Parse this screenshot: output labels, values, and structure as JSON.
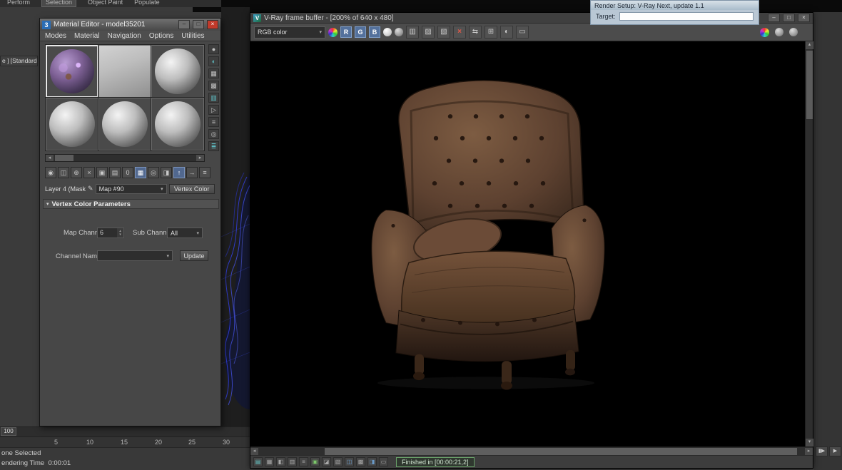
{
  "desktop": {
    "ribbon_tabs": [
      "Perform",
      "Selection",
      "Object Paint",
      "Populate"
    ],
    "left_fragment_text": "e ] [Standard",
    "timeline_ticks": [
      "5",
      "10",
      "15",
      "20",
      "25",
      "30"
    ],
    "frame_slider_value": "100",
    "status_selected": "one Selected",
    "status_render_time": "endering Time  0:00:01",
    "playback_icons": [
      "▮▶",
      "▶"
    ]
  },
  "render_setup": {
    "title": "Render Setup: V-Ray Next, update 1.1",
    "target_label": "Target:"
  },
  "material_editor": {
    "title": "Material Editor - model35201",
    "menus": [
      "Modes",
      "Material",
      "Navigation",
      "Options",
      "Utilities"
    ],
    "toolbar_icons": [
      "◉",
      "◫",
      "⊕",
      "×",
      "▣",
      "▤",
      "0",
      "▦",
      "◎",
      "◨",
      "↑",
      "→",
      "≡"
    ],
    "side_icons": [
      "●",
      "◐",
      "▦",
      "▩",
      "▥",
      "▷",
      "≡",
      "◎",
      "≣"
    ],
    "layer_label": "Layer 4 (Mask",
    "map_dropdown_value": "Map #90",
    "type_button_label": "Vertex Color",
    "rollout_title": "Vertex Color Parameters",
    "map_channel_label": "Map Channel",
    "map_channel_value": "6",
    "sub_channel_label": "Sub Channel",
    "sub_channel_value": "All",
    "channel_name_label": "Channel Name",
    "update_button_label": "Update"
  },
  "vfb": {
    "title": "V-Ray frame buffer - [200% of 640 x 480]",
    "channel_select_value": "RGB color",
    "rgb_buttons": [
      "R",
      "G",
      "B"
    ],
    "tool_icons": [
      "▥",
      "▨",
      "▧",
      "×",
      "⇆",
      "⊞",
      "◐",
      "▭"
    ],
    "status_icons": [
      "▤",
      "▦",
      "◧",
      "▥",
      "≡",
      "▣",
      "◪",
      "▧",
      "◫",
      "▩",
      "◨",
      "▭"
    ],
    "status_message": "Finished in [00:00:21,2]"
  },
  "icons": {
    "me_logo": "3",
    "vfb_logo": "V",
    "minimize": "–",
    "maximize": "□",
    "close": "×",
    "dropdown_arrow": "▾",
    "spin_up": "▴",
    "spin_down": "▾",
    "left_arrow": "◂",
    "right_arrow": "▸",
    "up_arrow": "▴",
    "down_arrow": "▾",
    "rollout_arrow": "▾",
    "pencil": "✎"
  }
}
